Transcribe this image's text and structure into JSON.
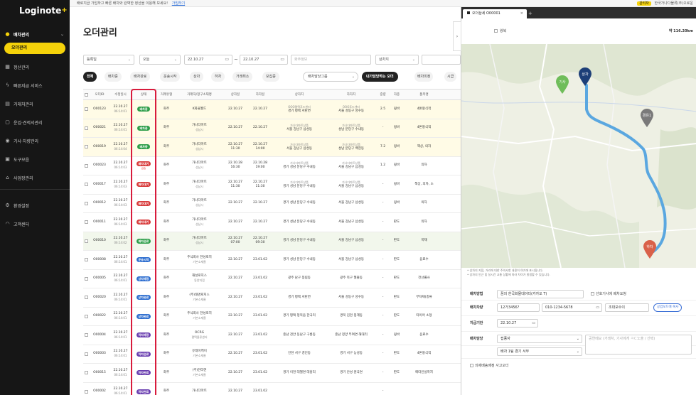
{
  "topbar": {
    "notice": "배로지급 가입하고 빠른 배차와 완벽한 정산을 이용해 보세요!",
    "link": "가입하기",
    "badge": "관리자",
    "company": "한국가나다물류(주)오로운"
  },
  "sidebar": {
    "logo": "Loginote",
    "logo_plus": "+",
    "items": [
      {
        "label": "배차관리",
        "icon": "truck-icon",
        "active": true
      },
      {
        "label": "정산관리",
        "icon": "calculator-icon"
      },
      {
        "label": "빠른지급 서비스",
        "icon": "lightning-icon"
      },
      {
        "label": "거래처관리",
        "icon": "building-icon"
      },
      {
        "label": "운임·견적서관리",
        "icon": "document-icon"
      },
      {
        "label": "기사·차량관리",
        "icon": "driver-icon"
      },
      {
        "label": "도구모음",
        "icon": "toolbox-icon"
      },
      {
        "label": "사업장관리",
        "icon": "home-icon"
      },
      {
        "label": "환경설정",
        "icon": "gear-icon"
      },
      {
        "label": "고객센터",
        "icon": "headset-icon"
      }
    ],
    "sub_active": "오더관리"
  },
  "main": {
    "title": "오더관리",
    "filters": {
      "date_type": "등록일",
      "period": "오늘",
      "date_from": "22.10.27",
      "date_to": "22.10.27",
      "shipper_placeholder": "화주정보",
      "search_type": "상차지"
    },
    "tabs": [
      "전체",
      "배차중",
      "배차완료",
      "운송시작",
      "상차",
      "하차",
      "거래취소",
      "모집중"
    ],
    "tab_group": "배차담당그룹",
    "tab_dark": "내가담당하는 오더",
    "tab_extra": [
      "배차미정",
      "시급"
    ],
    "columns": [
      "오더ID",
      "수정일시",
      "상태",
      "거래유형",
      "거래처/청구소재명",
      "상차일",
      "하차일",
      "상차지",
      "하차지",
      "중량",
      "차종",
      "품목명"
    ],
    "rows": [
      {
        "id": "O00123",
        "date": "22.10.27",
        "time": "06:14:01",
        "status": "배차중",
        "color": "#2e9e4a",
        "note": "",
        "type": "화주",
        "company": "K화물월드",
        "company_sub": "",
        "load_d": "22.10.27",
        "load_t": "",
        "unload_d": "22.10.27",
        "unload_t": "",
        "from_1": "OOO평택푸드센터",
        "from_2": "경기 평택 서탄면",
        "to_1": "OOO푸드센터",
        "to_2": "서울 성동구 성수동",
        "weight": "2.5",
        "truck": "윙바",
        "item": "4톤왕식적",
        "bg": "yellow"
      },
      {
        "id": "O00021",
        "date": "22.10.27",
        "time": "06:14:01",
        "status": "배차중",
        "color": "#2e9e4a",
        "note": "",
        "type": "화주",
        "company": "가나다마트",
        "company_sub": "성남시",
        "load_d": "22.10.27",
        "load_t": "",
        "unload_d": "22.10.27",
        "unload_t": "",
        "from_1": "가나다마트상품",
        "from_2": "서울 강남구 삼성동",
        "to_1": "가나다마트상품",
        "to_2": "성남 분당구 수내동",
        "weight": "-",
        "truck": "윙바",
        "item": "4톤왕식적",
        "bg": "yellow"
      },
      {
        "id": "O00019",
        "date": "22.10.27",
        "time": "06:14:04",
        "status": "배차중",
        "color": "#2e9e4a",
        "note": "",
        "type": "화주",
        "company": "가나다마트",
        "company_sub": "성남시",
        "load_d": "22.10.27",
        "load_t": "11:30",
        "unload_d": "22.10.27",
        "unload_t": "14:00",
        "from_1": "가나다마트상품",
        "from_2": "서울 강남구 삼성동",
        "to_1": "가나다마트상품",
        "to_2": "성남 분당구 백현동",
        "weight": "7.2",
        "truck": "윙바",
        "item": "책상, 의자",
        "bg": "yellow"
      },
      {
        "id": "O00023",
        "date": "22.10.27",
        "time": "06:14:03",
        "status": "배차대기",
        "color": "#d83c3c",
        "note": "급송",
        "type": "화주",
        "company": "가나다마트",
        "company_sub": "성남시",
        "load_d": "22.10.28",
        "load_t": "16:30",
        "unload_d": "22.10.28",
        "unload_t": "19:00",
        "from_1": "가나다마트상품",
        "from_2": "경기 성남 분당구 수내동",
        "to_1": "가나다마트상품",
        "to_2": "서울 강남구 삼성동",
        "weight": "1.2",
        "truck": "윙바",
        "item": "의자",
        "bg": ""
      },
      {
        "id": "O00017",
        "date": "22.10.27",
        "time": "06:14:03",
        "status": "배차대기",
        "color": "#d83c3c",
        "note": "",
        "type": "화주",
        "company": "가나다마트",
        "company_sub": "성남시",
        "load_d": "22.10.27",
        "load_t": "11:30",
        "unload_d": "22.10.27",
        "unload_t": "11:30",
        "from_1": "가나다마트상품",
        "from_2": "경기 성남 분당구 수내동",
        "to_1": "가나다마트상품",
        "to_2": "서울 강남구 삼성동",
        "weight": "-",
        "truck": "윙바",
        "item": "책상, 의자, 소",
        "bg": ""
      },
      {
        "id": "O00012",
        "date": "22.10.27",
        "time": "06:14:03",
        "status": "배차대기",
        "color": "#d83c3c",
        "note": "",
        "type": "화주",
        "company": "가나다마트",
        "company_sub": "성남시",
        "load_d": "22.10.27",
        "load_t": "",
        "unload_d": "22.10.27",
        "unload_t": "",
        "from_1": "",
        "from_2": "경기 성남 분당구 수내동",
        "to_1": "",
        "to_2": "서울 강남구 삼성동",
        "weight": "-",
        "truck": "윙바",
        "item": "의자",
        "bg": ""
      },
      {
        "id": "O00011",
        "date": "22.10.27",
        "time": "06:14:03",
        "status": "배차대기",
        "color": "#d83c3c",
        "note": "",
        "type": "화주",
        "company": "가나다마트",
        "company_sub": "성남시",
        "load_d": "22.10.27",
        "load_t": "",
        "unload_d": "22.10.27",
        "unload_t": "",
        "from_1": "",
        "from_2": "경기 성남 분당구 수내동",
        "to_1": "",
        "to_2": "서울 강남구 삼성동",
        "weight": "-",
        "truck": "판도",
        "item": "의자",
        "bg": ""
      },
      {
        "id": "O00010",
        "date": "22.10.27",
        "time": "06:14:02",
        "status": "배차완료",
        "color": "#2e9e4a",
        "note": "",
        "type": "화주",
        "company": "가나다마트",
        "company_sub": "성남시",
        "load_d": "22.10.27",
        "load_t": "07:00",
        "unload_d": "22.10.27",
        "unload_t": "09:30",
        "from_1": "",
        "from_2": "경기 성남 분당구 수내동",
        "to_1": "",
        "to_2": "서울 강남구 삼성동",
        "weight": "-",
        "truck": "판도",
        "item": "목재",
        "bg": "green"
      },
      {
        "id": "O00008",
        "date": "22.10.27",
        "time": "06:14:01",
        "status": "운송시작",
        "color": "#2f6fd0",
        "note": "",
        "type": "화주",
        "company": "주식회사 한성로지",
        "company_sub": "기본소재율",
        "load_d": "22.10.27",
        "load_t": "",
        "unload_d": "23.01.02",
        "unload_t": "",
        "from_1": "",
        "from_2": "경기 성남 분당구 수내동",
        "to_1": "",
        "to_2": "서울 강남구 삼성동",
        "weight": "-",
        "truck": "판도",
        "item": "음료수",
        "bg": ""
      },
      {
        "id": "O00005",
        "date": "22.10.27",
        "time": "06:14:01",
        "status": "상차예정",
        "color": "#2f6fd0",
        "note": "",
        "type": "화주",
        "company": "해성로지스",
        "company_sub": "동양지점",
        "load_d": "22.10.27",
        "load_t": "",
        "unload_d": "23.01.02",
        "unload_t": "",
        "from_1": "",
        "from_2": "광주 남구 봉림동",
        "to_1": "",
        "to_2": "광주 북구 월출동",
        "weight": "-",
        "truck": "판도",
        "item": "전선롤사",
        "bg": ""
      },
      {
        "id": "O00020",
        "date": "22.10.27",
        "time": "06:14:01",
        "status": "상차완료",
        "color": "#2f6fd0",
        "note": "",
        "type": "화주",
        "company": "(주)태명로지스",
        "company_sub": "기본소재율",
        "load_d": "22.10.27",
        "load_t": "",
        "unload_d": "23.01.02",
        "unload_t": "",
        "from_1": "",
        "from_2": "경기 평택 서탄면",
        "to_1": "",
        "to_2": "서울 성동구 성수동",
        "weight": "-",
        "truck": "판도",
        "item": "부자재(종류",
        "bg": ""
      },
      {
        "id": "O00022",
        "date": "22.10.27",
        "time": "06:14:01",
        "status": "상차완료",
        "color": "#2f6fd0",
        "note": "",
        "type": "화주",
        "company": "주식회사 한성로지",
        "company_sub": "기본소재율",
        "load_d": "22.10.27",
        "load_t": "",
        "unload_d": "23.01.02",
        "unload_t": "",
        "from_1": "",
        "from_2": "경기 평택 청북읍 한국리",
        "to_1": "",
        "to_2": "경북 김천 봉계동",
        "weight": "-",
        "truck": "판도",
        "item": "타이어 소형",
        "bg": ""
      },
      {
        "id": "O00004",
        "date": "22.10.27",
        "time": "06:14:01",
        "status": "하차예정",
        "color": "#6a3fb0",
        "note": "",
        "type": "화주",
        "company": "OCRG",
        "company_sub": "평택물류센터",
        "load_d": "22.10.27",
        "load_t": "",
        "unload_d": "23.01.02",
        "unload_t": "",
        "from_1": "",
        "from_2": "충남 천안 동남구 구룡동",
        "to_1": "",
        "to_2": "충남 청양 부여면 해대리",
        "weight": "-",
        "truck": "윙바",
        "item": "음료수",
        "bg": ""
      },
      {
        "id": "O00003",
        "date": "22.10.27",
        "time": "06:14:01",
        "status": "하차완료",
        "color": "#6a3fb0",
        "note": "",
        "type": "화주",
        "company": "유레이케이",
        "company_sub": "기본소재율",
        "load_d": "22.10.27",
        "load_t": "",
        "unload_d": "23.01.02",
        "unload_t": "",
        "from_1": "",
        "from_2": "인천 서구 경인동",
        "to_1": "",
        "to_2": "경기 서구 능성동",
        "weight": "-",
        "truck": "판도",
        "item": "4톤왕식적",
        "bg": ""
      },
      {
        "id": "O00015",
        "date": "22.10.27",
        "time": "06:14:01",
        "status": "하차완료",
        "color": "#6a3fb0",
        "note": "",
        "type": "화주",
        "company": "(주)한라연",
        "company_sub": "기본소재율",
        "load_d": "22.10.27",
        "load_t": "",
        "unload_d": "23.01.02",
        "unload_t": "",
        "from_1": "",
        "from_2": "경기 이천 대월면 대흥리",
        "to_1": "",
        "to_2": "경기 안성 원곡면",
        "weight": "-",
        "truck": "판도",
        "item": "메타인실학지",
        "bg": ""
      },
      {
        "id": "O00002",
        "date": "22.10.27",
        "time": "06:14:01",
        "status": "하차완료",
        "color": "#6a3fb0",
        "note": "",
        "type": "화주",
        "company": "가나다마트",
        "company_sub": "",
        "load_d": "22.10.27",
        "load_t": "",
        "unload_d": "23.01.02",
        "unload_t": "",
        "from_1": "",
        "from_2": "",
        "to_1": "",
        "to_2": "",
        "weight": "-",
        "truck": "",
        "item": "",
        "bg": ""
      }
    ]
  },
  "panel": {
    "tab_label": "오더상세 O00001",
    "checkbox_label": "왕복",
    "distance": "약 116.20km",
    "markers": {
      "pickup": "상차",
      "driver": "기사",
      "waypoint": "경유1",
      "dropoff": "하차"
    },
    "notes": [
      "• 상차지 지점, 거리에 대한 주의사항 내용이 여기에 표시됩니다.",
      "• 상차지 인근 및 실시간 교통 상황에 따라 차이가 발생할 수 있습니다."
    ],
    "form": {
      "dispatch_method_label": "배차방법",
      "dispatch_method_value": "꿈의 한국화물데이터(카카오 T)",
      "dispatch_check": "선호기사에 배차요청",
      "driver_label": "배차차량",
      "vehicle_no": "12가3456?",
      "phone": "010-1234-5678",
      "driver_name": "조대모수이",
      "driver_btn": "공업보드에 복사",
      "pay_label": "지급기한",
      "pay_date": "22.10.27",
      "manager_label": "배차담당",
      "manager_type": "접종자",
      "manager_ph": "공연메모 (거래처, 기사에게 ㅋㄷ노출 / 선택)",
      "manager_name": "배차 1팀 경기 서부",
      "bottom_check": "의제배송배정 사고오더"
    }
  }
}
